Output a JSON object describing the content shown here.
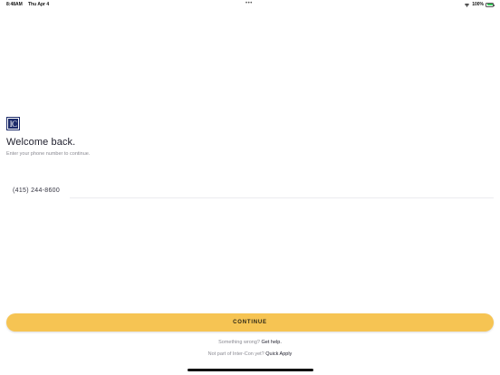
{
  "status_bar": {
    "time": "8:48AM",
    "date": "Thu Apr 4",
    "dots": "•••",
    "battery_percent": "100%",
    "icons": [
      "wifi-icon",
      "battery-icon"
    ],
    "battery_color": "#35c759"
  },
  "logo": {
    "text": "IC",
    "background": "#1d2c6b"
  },
  "login": {
    "title": "Welcome back.",
    "subtitle": "Enter your phone number to continue.",
    "phone_value": "(415) 244-8600"
  },
  "actions": {
    "continue_label": "CONTINUE",
    "continue_color": "#f6c453"
  },
  "footer": {
    "help_prompt": "Something wrong?",
    "help_link": "Get help.",
    "apply_prompt": "Not part of Inter-Con yet?",
    "apply_link": "Quick Apply"
  }
}
